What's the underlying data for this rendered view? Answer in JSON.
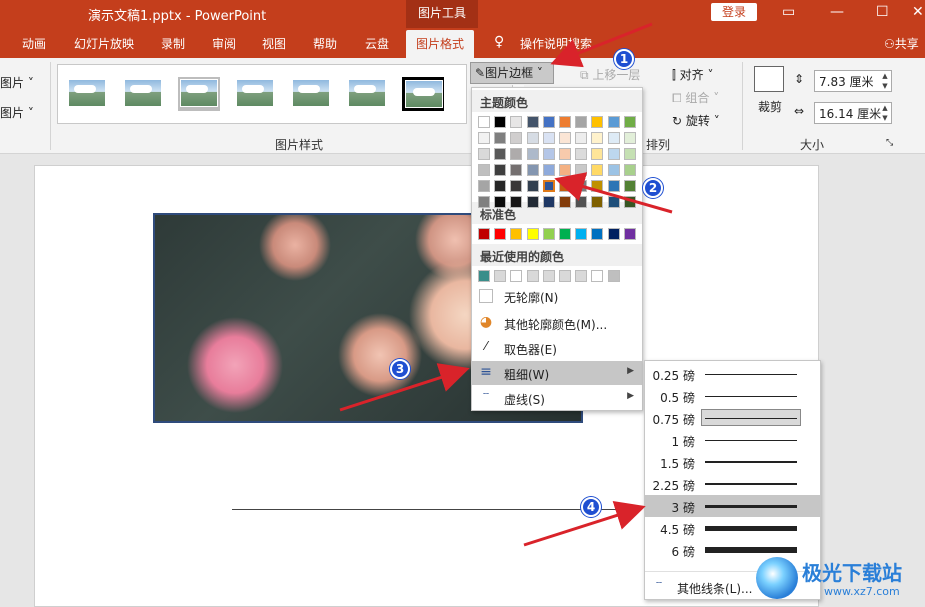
{
  "titlebar": {
    "doc_title": "演示文稿1.pptx  -  PowerPoint",
    "context_tab": "图片工具",
    "login_label": "登录"
  },
  "tabs": {
    "items": [
      "动画",
      "幻灯片放映",
      "录制",
      "审阅",
      "视图",
      "帮助",
      "云盘",
      "图片格式"
    ],
    "active": "图片格式",
    "search_label": "操作说明搜索",
    "share_label": "共享"
  },
  "ribbon": {
    "left_buttons": [
      "图片",
      "图片"
    ],
    "picture_styles_label": "图片样式",
    "border_button_label": "图片边框",
    "bring_forward_label": "上移一层",
    "align_label": "对齐",
    "group_label": "组合",
    "rotate_label": "旋转",
    "arrange_label": "排列",
    "crop_label": "裁剪",
    "size_label": "大小",
    "height_value": "7.83 厘米",
    "width_value": "16.14 厘米"
  },
  "border_menu": {
    "theme_colors_label": "主题颜色",
    "standard_colors_label": "标准色",
    "recent_colors_label": "最近使用的颜色",
    "theme_top_row": [
      "#ffffff",
      "#000000",
      "#e7e6e6",
      "#44546a",
      "#4472c4",
      "#ed7d31",
      "#a5a5a5",
      "#ffc000",
      "#5b9bd5",
      "#70ad47"
    ],
    "theme_shades": [
      [
        "#f2f2f2",
        "#7f7f7f",
        "#d0cece",
        "#d6dce4",
        "#d9e2f3",
        "#fbe5d5",
        "#ededed",
        "#fff2cc",
        "#deebf6",
        "#e2efd9"
      ],
      [
        "#d9d9d9",
        "#595959",
        "#aeabab",
        "#adb9ca",
        "#b4c6e7",
        "#f7caac",
        "#dbdbdb",
        "#fee599",
        "#bdd7ee",
        "#c5e0b3"
      ],
      [
        "#bfbfbf",
        "#3f3f3f",
        "#757070",
        "#8496b0",
        "#8eaadb",
        "#f4b183",
        "#c9c9c9",
        "#ffd965",
        "#9cc3e5",
        "#a8d08d"
      ],
      [
        "#a5a5a5",
        "#262626",
        "#3a3838",
        "#323f4f",
        "#2f5496",
        "#c55a11",
        "#7b7b7b",
        "#bf9000",
        "#2e75b5",
        "#538135"
      ],
      [
        "#7f7f7f",
        "#0c0c0c",
        "#171616",
        "#222a35",
        "#1f3864",
        "#833c0b",
        "#525252",
        "#7f6000",
        "#1e4e79",
        "#375623"
      ]
    ],
    "standard_colors": [
      "#c00000",
      "#ff0000",
      "#ffc000",
      "#ffff00",
      "#92d050",
      "#00b050",
      "#00b0f0",
      "#0070c0",
      "#002060",
      "#7030a0"
    ],
    "recent_colors": [
      "#3a8e8a",
      "#d9d9d9",
      "#ffffff",
      "#d9d9d9",
      "#d9d9d9",
      "#d9d9d9",
      "#d9d9d9",
      "#ffffff",
      "#bfbfbf"
    ],
    "no_outline_label": "无轮廓(N)",
    "more_colors_label": "其他轮廓颜色(M)...",
    "eyedropper_label": "取色器(E)",
    "weight_label": "粗细(W)",
    "dashes_label": "虚线(S)"
  },
  "weight_menu": {
    "options": [
      "0.25 磅",
      "0.5 磅",
      "0.75 磅",
      "1 磅",
      "1.5 磅",
      "2.25 磅",
      "3 磅",
      "4.5 磅",
      "6 磅"
    ],
    "line_widths_pt": [
      0.25,
      0.5,
      0.75,
      1,
      1.5,
      2.25,
      3,
      4.5,
      6
    ],
    "current": "0.75 磅",
    "hovered": "3 磅",
    "more_lines_label": "其他线条(L)..."
  },
  "callouts": [
    "1",
    "2",
    "3",
    "4"
  ],
  "watermark": {
    "text": "极光下载站",
    "url": "www.xz7.com"
  },
  "colors": {
    "accent": "#c43e1c",
    "callout_blue": "#1f4fd1",
    "arrow_red": "#d9232a"
  }
}
